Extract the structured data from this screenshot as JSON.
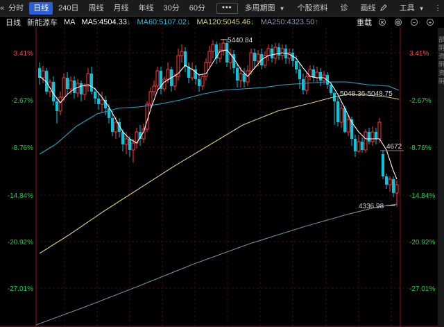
{
  "toolbar": {
    "collapse_icon": "«",
    "periods": [
      {
        "label": "分时",
        "active": false
      },
      {
        "label": "日线",
        "active": true
      },
      {
        "label": "240日",
        "active": false
      },
      {
        "label": "周线",
        "active": false
      },
      {
        "label": "月线",
        "active": false
      },
      {
        "label": "年线",
        "active": false
      },
      {
        "label": "30分",
        "active": false
      },
      {
        "label": "60分",
        "active": false
      }
    ],
    "more": "•••",
    "multi_period": "多周期图",
    "stock_info": "个股资料",
    "diagnose": "诊",
    "draw": "画线",
    "tools": "工具",
    "grid_icon": "⋮⋮"
  },
  "infobar": {
    "period": "日线",
    "name": "新能源车",
    "ma_label": "MA",
    "ma5": "MA5:4504.33",
    "ma60": "MA60:5107.02",
    "ma120": "MA120:5045.46",
    "ma250": "MA250:4323.50",
    "weight": "重载"
  },
  "colors": {
    "up": "#ff3b3b",
    "down": "#00c8e0",
    "ma5": "#ffffff",
    "ma60": "#27a7c9",
    "ma120": "#d8d27a",
    "ma250": "#7d8aa5",
    "grid": "#3a0d0d",
    "axis": "#8a1a1a"
  },
  "axis": {
    "labels": [
      "3.41%",
      "-2.67%",
      "-8.76%",
      "-14.84%",
      "-20.92%",
      "-27.01%"
    ]
  },
  "chart_data": {
    "type": "candlestick",
    "series": [
      "MA5",
      "MA60",
      "MA120",
      "MA250"
    ],
    "annotations": [
      "5440.84",
      "5048.36-5048.75",
      "4672",
      "4336.98"
    ],
    "y_axis_labels": [
      "3.41%",
      "-2.67%",
      "-8.76%",
      "-14.84%",
      "-20.92%",
      "-27.01%"
    ]
  },
  "side_text": [
    "部",
    "阴",
    "资",
    "阴",
    "资",
    "阴"
  ]
}
